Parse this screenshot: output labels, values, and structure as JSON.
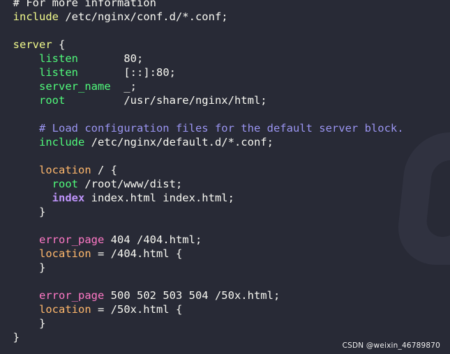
{
  "colors": {
    "background": "#282a36",
    "text": "#f8f8f2",
    "directive_yellow": "#f1fa8c",
    "directive_green": "#50fa7b",
    "directive_orange": "#ffb86c",
    "directive_pink": "#ff79c6",
    "keyword_purple": "#bd93f9",
    "comment": "#9b95f2"
  },
  "code_lines": [
    {
      "indent": "  ",
      "parts": [
        {
          "t": "# For more information",
          "c": "plain"
        }
      ]
    },
    {
      "indent": "  ",
      "parts": [
        {
          "t": "include",
          "c": "kw-yellow"
        },
        {
          "t": " /etc/nginx/conf.d/*.conf;",
          "c": "plain"
        }
      ]
    },
    {
      "indent": "",
      "parts": []
    },
    {
      "indent": "  ",
      "parts": [
        {
          "t": "server",
          "c": "kw-yellow"
        },
        {
          "t": " {",
          "c": "plain"
        }
      ]
    },
    {
      "indent": "      ",
      "parts": [
        {
          "t": "listen",
          "c": "kw-green"
        },
        {
          "t": "       80;",
          "c": "plain"
        }
      ]
    },
    {
      "indent": "      ",
      "parts": [
        {
          "t": "listen",
          "c": "kw-green"
        },
        {
          "t": "       [::]:80;",
          "c": "plain"
        }
      ]
    },
    {
      "indent": "      ",
      "parts": [
        {
          "t": "server_name",
          "c": "kw-green"
        },
        {
          "t": "  _;",
          "c": "plain"
        }
      ]
    },
    {
      "indent": "      ",
      "parts": [
        {
          "t": "root",
          "c": "kw-green"
        },
        {
          "t": "         /usr/share/nginx/html;",
          "c": "plain"
        }
      ]
    },
    {
      "indent": "",
      "parts": []
    },
    {
      "indent": "      ",
      "parts": [
        {
          "t": "# Load configuration files for the default server block.",
          "c": "comment"
        }
      ]
    },
    {
      "indent": "      ",
      "parts": [
        {
          "t": "include",
          "c": "kw-green"
        },
        {
          "t": " /etc/nginx/default.d/*.conf;",
          "c": "plain"
        }
      ]
    },
    {
      "indent": "",
      "parts": []
    },
    {
      "indent": "      ",
      "parts": [
        {
          "t": "location",
          "c": "kw-orange"
        },
        {
          "t": " / {",
          "c": "plain"
        }
      ]
    },
    {
      "indent": "        ",
      "parts": [
        {
          "t": "root",
          "c": "kw-green"
        },
        {
          "t": " /root/www/dist;",
          "c": "plain"
        }
      ]
    },
    {
      "indent": "        ",
      "parts": [
        {
          "t": "index",
          "c": "kw-purple"
        },
        {
          "t": " index.html index.html;",
          "c": "plain"
        }
      ]
    },
    {
      "indent": "      ",
      "parts": [
        {
          "t": "}",
          "c": "plain"
        }
      ]
    },
    {
      "indent": "",
      "parts": []
    },
    {
      "indent": "      ",
      "parts": [
        {
          "t": "error_page",
          "c": "kw-pink"
        },
        {
          "t": " 404 /404.html;",
          "c": "plain"
        }
      ]
    },
    {
      "indent": "      ",
      "parts": [
        {
          "t": "location",
          "c": "kw-orange"
        },
        {
          "t": " = /404.html {",
          "c": "plain"
        }
      ]
    },
    {
      "indent": "      ",
      "parts": [
        {
          "t": "}",
          "c": "plain"
        }
      ]
    },
    {
      "indent": "",
      "parts": []
    },
    {
      "indent": "      ",
      "parts": [
        {
          "t": "error_page",
          "c": "kw-pink"
        },
        {
          "t": " 500 502 503 504 /50x.html;",
          "c": "plain"
        }
      ]
    },
    {
      "indent": "      ",
      "parts": [
        {
          "t": "location",
          "c": "kw-orange"
        },
        {
          "t": " = /50x.html {",
          "c": "plain"
        }
      ]
    },
    {
      "indent": "      ",
      "parts": [
        {
          "t": "}",
          "c": "plain"
        }
      ]
    },
    {
      "indent": "  ",
      "parts": [
        {
          "t": "}",
          "c": "plain"
        }
      ]
    }
  ],
  "watermark": {
    "text": "CSDN @weixin_46789870"
  }
}
